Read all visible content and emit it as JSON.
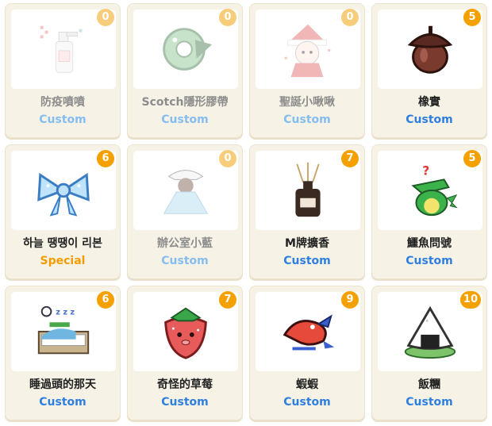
{
  "colors": {
    "card_bg": "#f6f2e6",
    "badge": "#f4a100",
    "badge_disabled": "#f7cd7c",
    "custom_tag": "#2f7fe0",
    "custom_tag_disabled": "#86bdf0",
    "special_tag": "#f39c00"
  },
  "items": [
    {
      "name": "防疫噴噴",
      "tag": "Custom",
      "count": "0",
      "icon": "disinfectant-spray-icon",
      "disabled": true
    },
    {
      "name": "Scotch隱形膠帶",
      "tag": "Custom",
      "count": "0",
      "icon": "tape-monster-icon",
      "disabled": true
    },
    {
      "name": "聖誕小啾啾",
      "tag": "Custom",
      "count": "0",
      "icon": "santa-girl-icon",
      "disabled": true
    },
    {
      "name": "橡實",
      "tag": "Custom",
      "count": "5",
      "icon": "acorn-icon",
      "disabled": false
    },
    {
      "name": "하늘 땡땡이 리본",
      "tag": "Special",
      "count": "6",
      "icon": "blue-ribbon-icon",
      "disabled": false
    },
    {
      "name": "辦公室小藍",
      "tag": "Custom",
      "count": "0",
      "icon": "office-blue-icon",
      "disabled": true
    },
    {
      "name": "M牌擴香",
      "tag": "Custom",
      "count": "7",
      "icon": "reed-diffuser-icon",
      "disabled": false
    },
    {
      "name": "鱷魚問號",
      "tag": "Custom",
      "count": "5",
      "icon": "crocodile-question-icon",
      "disabled": false
    },
    {
      "name": "睡過頭的那天",
      "tag": "Custom",
      "count": "6",
      "icon": "sleeping-bed-icon",
      "disabled": false
    },
    {
      "name": "奇怪的草莓",
      "tag": "Custom",
      "count": "7",
      "icon": "strawberry-icon",
      "disabled": false
    },
    {
      "name": "蝦蝦",
      "tag": "Custom",
      "count": "9",
      "icon": "shrimp-icon",
      "disabled": false
    },
    {
      "name": "飯糰",
      "tag": "Custom",
      "count": "10",
      "icon": "rice-ball-icon",
      "disabled": false
    }
  ]
}
